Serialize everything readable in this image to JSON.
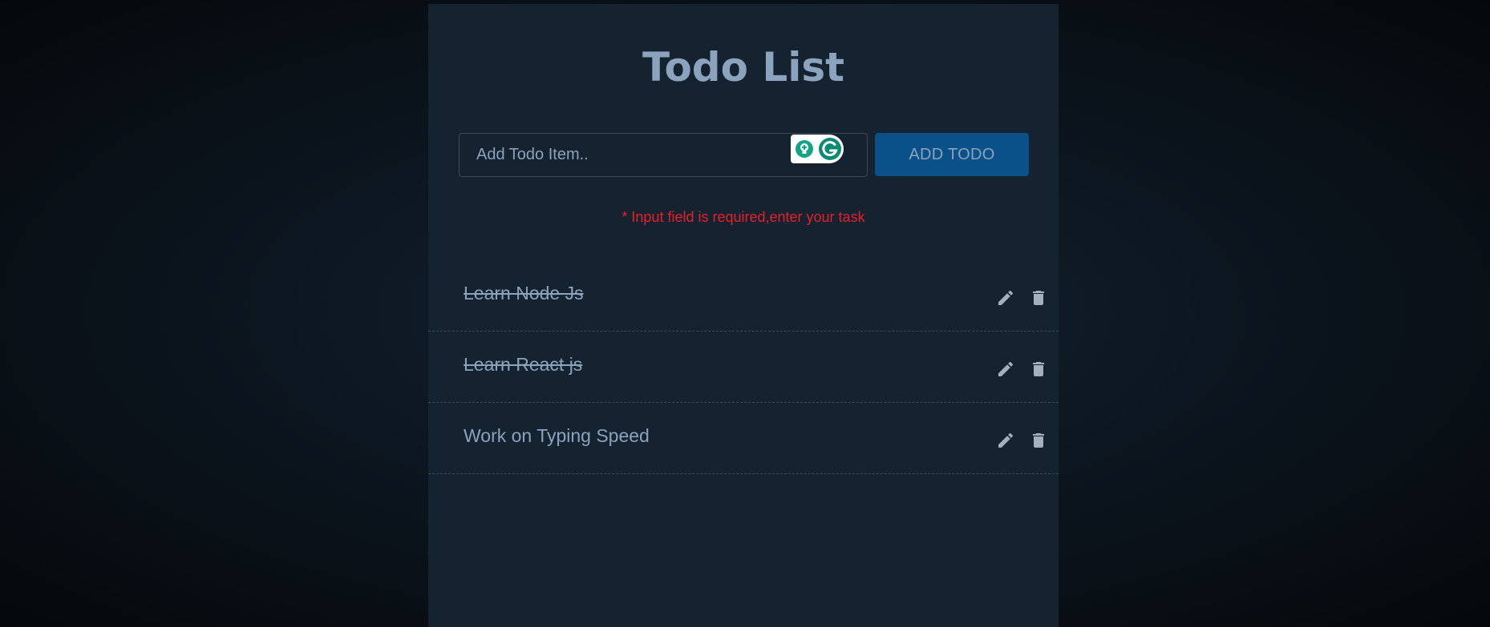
{
  "app": {
    "title": "Todo List"
  },
  "input": {
    "placeholder": "Add Todo Item..",
    "value": ""
  },
  "add_button": {
    "label": "ADD TODO"
  },
  "error": {
    "message": "* Input field is required,enter your task"
  },
  "todos": [
    {
      "text": "Learn Node Js",
      "completed": true
    },
    {
      "text": "Learn React js",
      "completed": true
    },
    {
      "text": "Work on Typing Speed",
      "completed": false
    }
  ],
  "icons": {
    "edit": "pencil-icon",
    "delete": "trash-icon",
    "grammarly": "grammarly-icon",
    "suggestion": "lightbulb-icon"
  },
  "colors": {
    "panel_background": "#15222f",
    "text": "#8ba3bc",
    "button_background": "#0a5189",
    "error": "#e8202b",
    "icon": "#a3b1bf",
    "grammarly_green": "#15c39a"
  }
}
